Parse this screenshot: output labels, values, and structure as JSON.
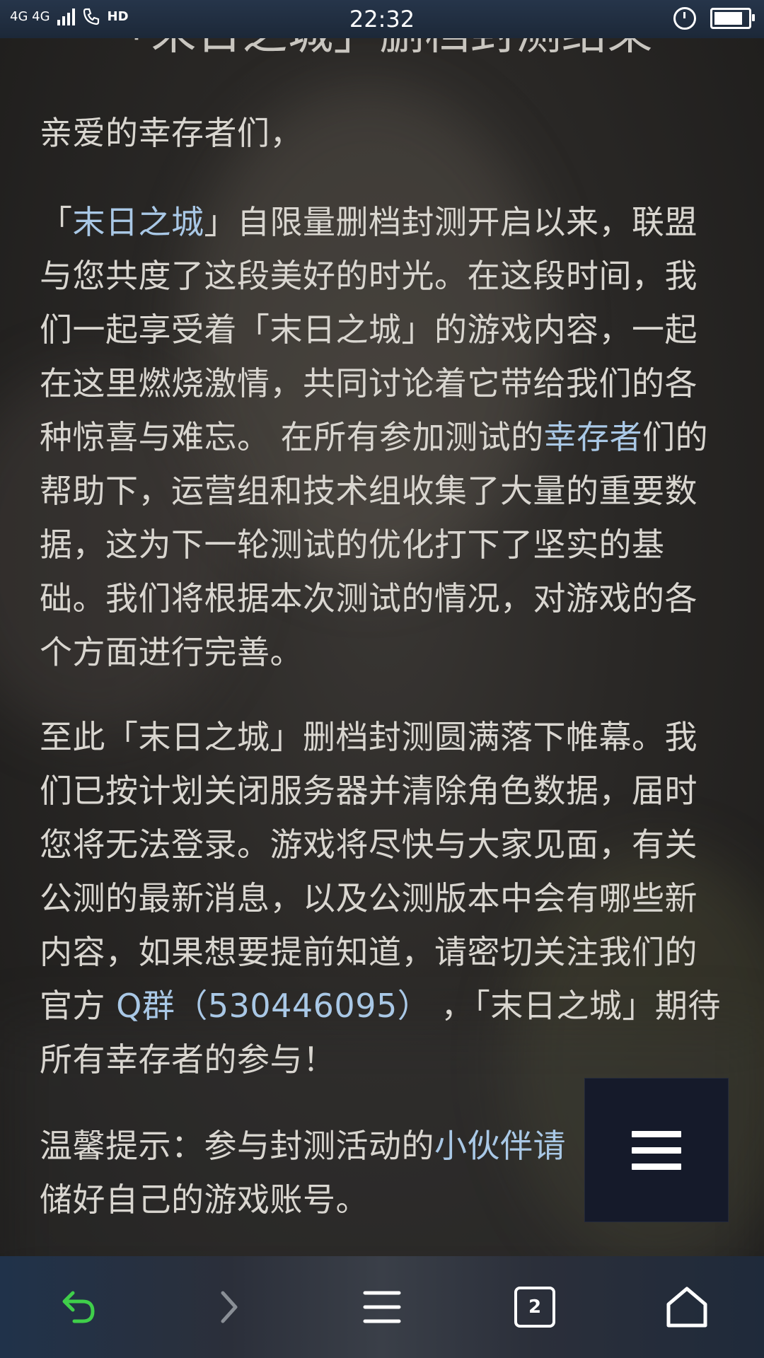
{
  "status_bar": {
    "network": "4G 4G",
    "hd": "HD",
    "time": "22:32"
  },
  "article": {
    "title": "「末日之城」删档封测结果",
    "greeting": "亲爱的幸存者们，",
    "p1": {
      "quote_open": "「",
      "game_link": "末日之城",
      "after_link": "」自限量删档封测开启以来，联盟与您共度了这段美好的时光。在这段时间，我们一起享受着「末日之城」的游戏内容，一起在这里燃烧激情，共同讨论着它带给我们的各种惊喜与难忘。 在所有参加测试的",
      "survivor_link": "幸存者",
      "tail": "们的帮助下，运营组和技术组收集了大量的重要数据，这为下一轮测试的优化打下了坚实的基础。我们将根据本次测试的情况，对游戏的各个方面进行完善。"
    },
    "p2": {
      "before_link": "至此「末日之城」删档封测圆满落下帷幕。我们已按计划关闭服务器并清除角色数据，届时您将无法登录。游戏将尽快与大家见面，有关公测的最新消息，以及公测版本中会有哪些新内容，如果想要提前知道，请密切关注我们的官方 ",
      "qq_link": "Q群（530446095）",
      "after_link": " ，「末日之城」期待所有幸存者的参与！"
    },
    "p3": {
      "before_link": "温馨提示：参与封测活动的",
      "partner_link": "小伙伴请",
      "tail": "储好自己的游戏账号。"
    }
  },
  "floating_menu": {
    "icon": "hamburger-icon"
  },
  "bottom_nav": {
    "tab_count": "2",
    "icons": [
      "back-icon",
      "forward-icon",
      "menu-icon",
      "tabs-icon",
      "home-icon"
    ],
    "back_color": "#3fcf4a"
  }
}
